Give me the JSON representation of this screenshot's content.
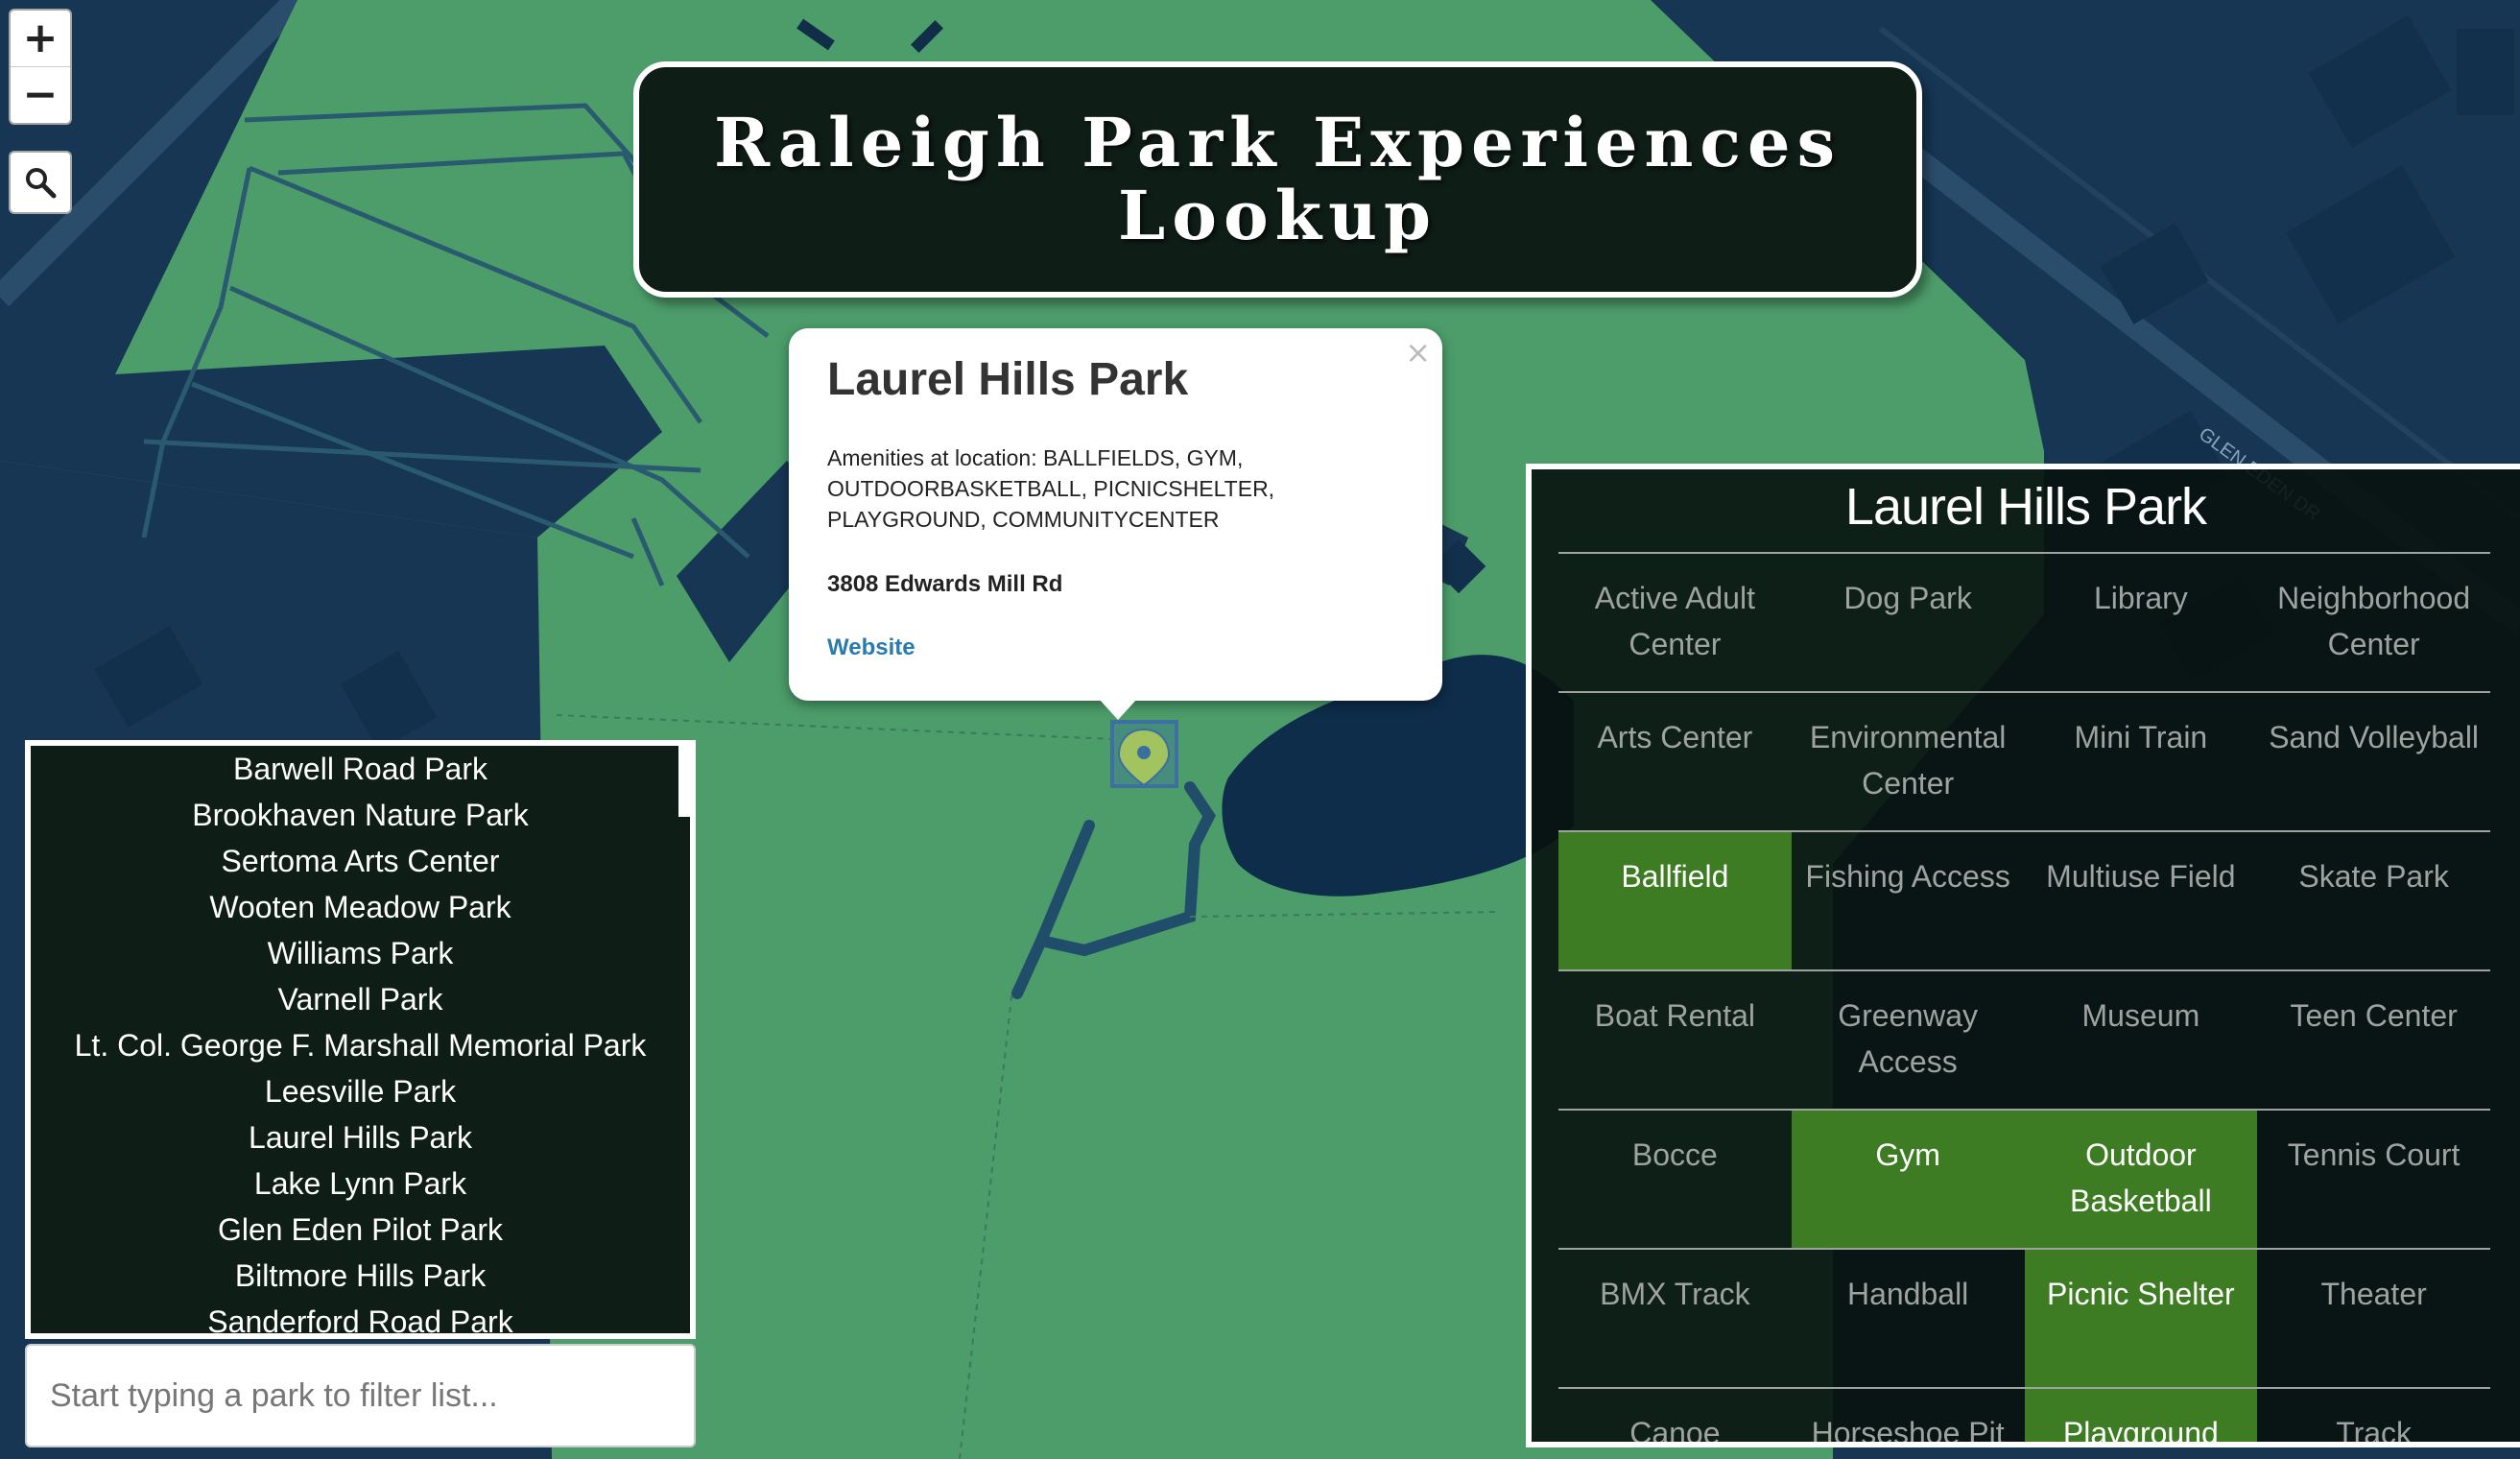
{
  "title": "Raleigh Park Experiences Lookup",
  "controls": {
    "zoom_in": "+",
    "zoom_out": "−"
  },
  "map": {
    "colors": {
      "park": "#4c9d6a",
      "background": "#163654",
      "water": "#0d2d4a"
    },
    "street_label": "GLEN EDEN DR"
  },
  "popup": {
    "title": "Laurel Hills Park",
    "close": "×",
    "amenities": "Amenities at location: BALLFIELDS, GYM, OUTDOORBASKETBALL, PICNICSHELTER, PLAYGROUND, COMMUNITYCENTER",
    "address": "3808 Edwards Mill Rd",
    "website_label": "Website"
  },
  "park_list": [
    "Barwell Road Park",
    "Brookhaven Nature Park",
    "Sertoma Arts Center",
    "Wooten Meadow Park",
    "Williams Park",
    "Varnell Park",
    "Lt. Col. George F. Marshall Memorial Park",
    "Leesville Park",
    "Laurel Hills Park",
    "Lake Lynn Park",
    "Glen Eden Pilot Park",
    "Biltmore Hills Park",
    "Sanderford Road Park"
  ],
  "filter": {
    "placeholder": "Start typing a park to filter list..."
  },
  "amenity_panel": {
    "title": "Laurel Hills Park",
    "active_color": "#3d7c22",
    "rows": [
      [
        {
          "label": "Active Adult Center",
          "active": false
        },
        {
          "label": "Dog Park",
          "active": false
        },
        {
          "label": "Library",
          "active": false
        },
        {
          "label": "Neighborhood Center",
          "active": false
        }
      ],
      [
        {
          "label": "Arts Center",
          "active": false
        },
        {
          "label": "Environmental Center",
          "active": false
        },
        {
          "label": "Mini Train",
          "active": false
        },
        {
          "label": "Sand Volleyball",
          "active": false
        }
      ],
      [
        {
          "label": "Ballfield",
          "active": true
        },
        {
          "label": "Fishing Access",
          "active": false
        },
        {
          "label": "Multiuse Field",
          "active": false
        },
        {
          "label": "Skate Park",
          "active": false
        }
      ],
      [
        {
          "label": "Boat Rental",
          "active": false
        },
        {
          "label": "Greenway Access",
          "active": false
        },
        {
          "label": "Museum",
          "active": false
        },
        {
          "label": "Teen Center",
          "active": false
        }
      ],
      [
        {
          "label": "Bocce",
          "active": false
        },
        {
          "label": "Gym",
          "active": true
        },
        {
          "label": "Outdoor Basketball",
          "active": true
        },
        {
          "label": "Tennis Court",
          "active": false
        }
      ],
      [
        {
          "label": "BMX Track",
          "active": false
        },
        {
          "label": "Handball",
          "active": false
        },
        {
          "label": "Picnic Shelter",
          "active": true
        },
        {
          "label": "Theater",
          "active": false
        }
      ],
      [
        {
          "label": "Canoe",
          "active": false
        },
        {
          "label": "Horseshoe Pit",
          "active": false
        },
        {
          "label": "Playground",
          "active": true
        },
        {
          "label": "Track",
          "active": false
        }
      ]
    ]
  }
}
